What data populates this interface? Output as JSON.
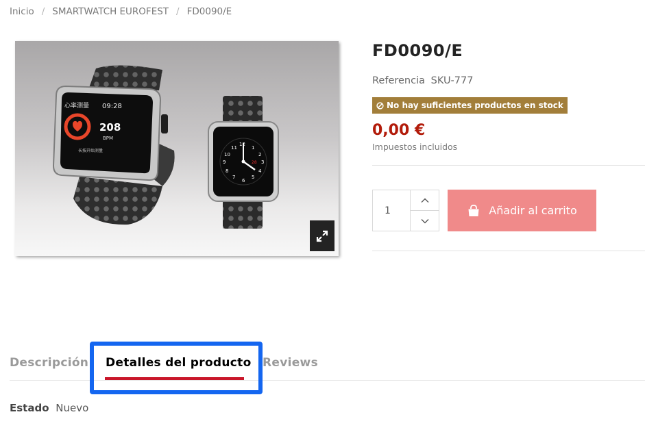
{
  "breadcrumb": {
    "items": [
      "Inicio",
      "SMARTWATCH EUROFEST",
      "FD0090/E"
    ],
    "separator": "/"
  },
  "product": {
    "title": "FD0090/E",
    "reference_label": "Referencia",
    "reference_value": "SKU-777",
    "stock_message": "No hay suficientes productos en stock",
    "price": "0,00 €",
    "tax_note": "Impuestos incluidos",
    "quantity": "1",
    "add_to_cart_label": "Añadir al carrito",
    "image": {
      "watch_screen_text": {
        "header": "心率测量",
        "time": "09:28",
        "bpm_value": "208",
        "bpm_unit": "BPM",
        "footer": "长按开始测量"
      },
      "clock_numbers": [
        "12",
        "1",
        "2",
        "3",
        "4",
        "5",
        "6",
        "7",
        "8",
        "9",
        "10",
        "11"
      ],
      "clock_date": "28"
    }
  },
  "tabs": {
    "items": [
      "Descripción",
      "Detalles del producto",
      "Reviews"
    ],
    "active": "Detalles del producto"
  },
  "details": {
    "state_label": "Estado",
    "state_value": "Nuevo"
  },
  "colors": {
    "price": "#b21b0a",
    "stock_badge": "#a27e3a",
    "add_button": "#f08a8a",
    "highlight_border": "#1466f0",
    "active_tab_underline": "#c9162a"
  },
  "icons": {
    "stock": "ban-icon",
    "cart": "shopping-bag-icon",
    "expand": "expand-icon",
    "up": "chevron-up-icon",
    "down": "chevron-down-icon"
  }
}
